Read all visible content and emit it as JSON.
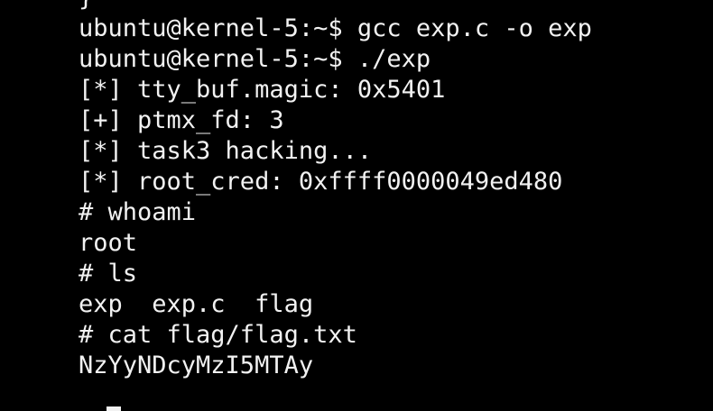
{
  "terminal": {
    "lines": [
      "}",
      "ubuntu@kernel-5:~$ gcc exp.c -o exp",
      "ubuntu@kernel-5:~$ ./exp",
      "[*] tty_buf.magic: 0x5401",
      "[+] ptmx_fd: 3",
      "[*] task3 hacking...",
      "[*] root_cred: 0xffff0000049ed480",
      "# whoami",
      "root",
      "# ls",
      "exp  exp.c  flag",
      "# cat flag/flag.txt",
      "NzYyNDcyMzI5MTAy"
    ],
    "colors": {
      "background": "#000000",
      "foreground": "#f2f2f2"
    }
  }
}
